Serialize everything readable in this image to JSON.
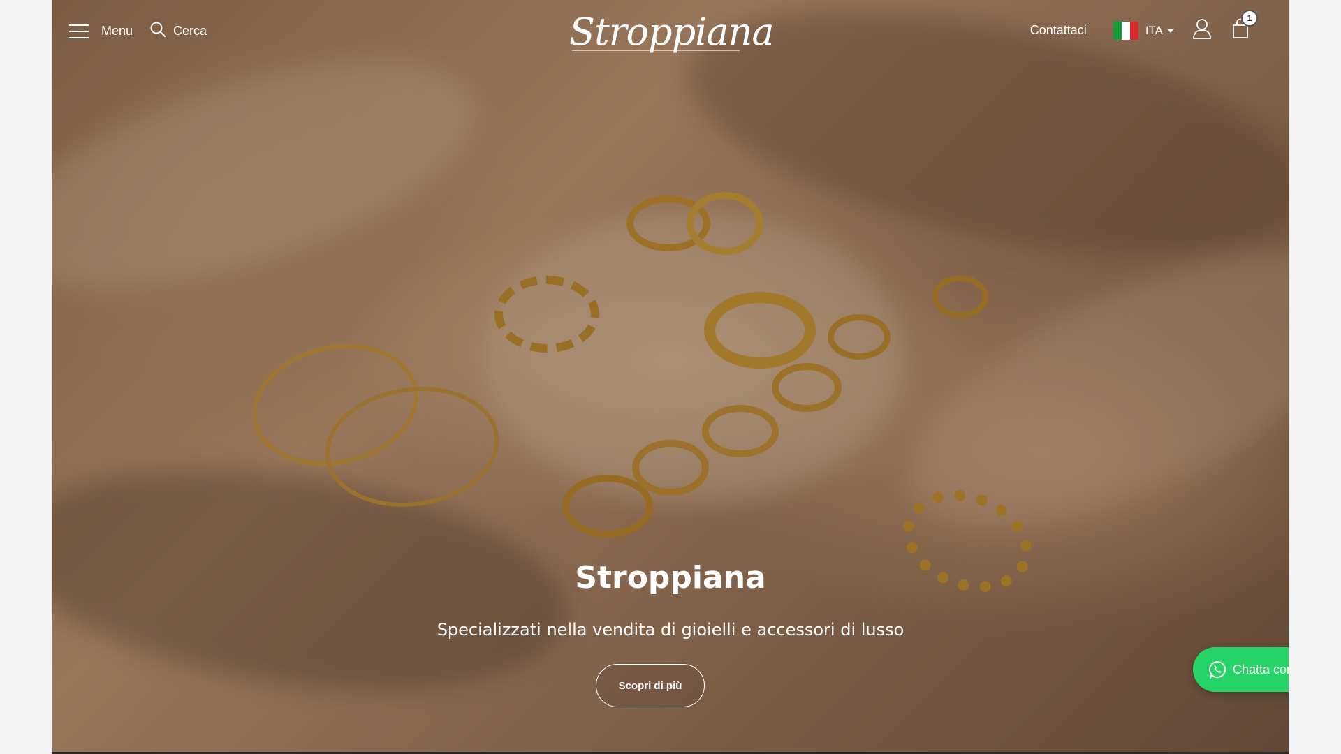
{
  "header": {
    "menu_label": "Menu",
    "search_label": "Cerca",
    "logo_text": "Stroppiana",
    "contact_label": "Contattaci",
    "language": "ITA",
    "cart_count": "1"
  },
  "hero": {
    "title": "Stroppiana",
    "subtitle": "Specializzati nella vendita di gioielli e accessori di lusso",
    "cta_label": "Scopri di più"
  },
  "chat": {
    "label": "Chatta con noi"
  },
  "colors": {
    "whatsapp_green": "#25d366",
    "flag_green": "#1a9b3a",
    "flag_red": "#d62b2b"
  },
  "icons": [
    "hamburger-icon",
    "search-icon",
    "italy-flag-icon",
    "caret-down-icon",
    "user-icon",
    "shopping-bag-icon",
    "whatsapp-icon"
  ]
}
